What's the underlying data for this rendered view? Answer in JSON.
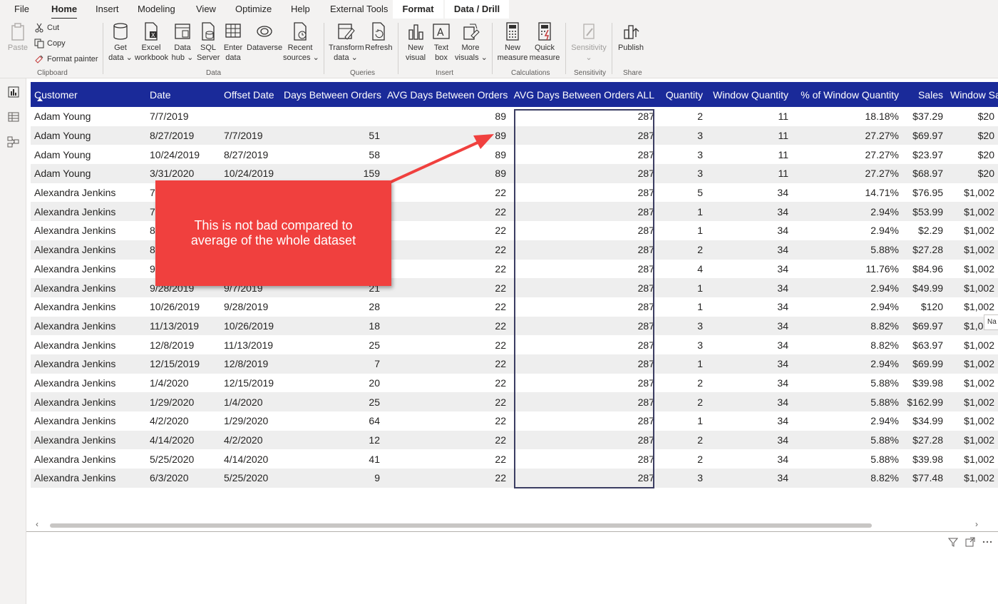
{
  "menu": {
    "file": "File",
    "home": "Home",
    "insert": "Insert",
    "modeling": "Modeling",
    "view": "View",
    "optimize": "Optimize",
    "help": "Help",
    "external_tools": "External Tools",
    "format": "Format",
    "data_drill": "Data / Drill"
  },
  "ribbon": {
    "clipboard": {
      "paste": "Paste",
      "cut": "Cut",
      "copy": "Copy",
      "format_painter": "Format painter",
      "label": "Clipboard"
    },
    "data": {
      "get_data": [
        "Get",
        "data ⌄"
      ],
      "excel": [
        "Excel",
        "workbook"
      ],
      "data_hub": [
        "Data",
        "hub ⌄"
      ],
      "sql": [
        "SQL",
        "Server"
      ],
      "enter": [
        "Enter",
        "data"
      ],
      "dataverse": [
        "Dataverse",
        ""
      ],
      "recent": [
        "Recent",
        "sources ⌄"
      ],
      "label": "Data"
    },
    "queries": {
      "transform": [
        "Transform",
        "data ⌄"
      ],
      "refresh": [
        "Refresh",
        ""
      ],
      "label": "Queries"
    },
    "insert": {
      "new_visual": [
        "New",
        "visual"
      ],
      "text_box": [
        "Text",
        "box"
      ],
      "more_visuals": [
        "More",
        "visuals ⌄"
      ],
      "label": "Insert"
    },
    "calculations": {
      "new_measure": [
        "New",
        "measure"
      ],
      "quick_measure": [
        "Quick",
        "measure"
      ],
      "label": "Calculations"
    },
    "sensitivity": {
      "sensitivity": [
        "Sensitivity",
        "⌄"
      ],
      "label": "Sensitivity"
    },
    "share": {
      "publish": [
        "Publish",
        ""
      ],
      "label": "Share"
    }
  },
  "table": {
    "columns": [
      "Customer",
      "Date",
      "Offset Date",
      "Days Between Orders",
      "AVG Days Between Orders",
      "AVG Days Between Orders ALL",
      "Quantity",
      "Window Quantity",
      "% of Window Quantity",
      "Sales",
      "Window Sa"
    ],
    "rows": [
      [
        "Adam Young",
        "7/7/2019",
        "",
        "",
        "89",
        "287",
        "2",
        "11",
        "18.18%",
        "$37.29",
        "$20"
      ],
      [
        "Adam Young",
        "8/27/2019",
        "7/7/2019",
        "51",
        "89",
        "287",
        "3",
        "11",
        "27.27%",
        "$69.97",
        "$20"
      ],
      [
        "Adam Young",
        "10/24/2019",
        "8/27/2019",
        "58",
        "89",
        "287",
        "3",
        "11",
        "27.27%",
        "$23.97",
        "$20"
      ],
      [
        "Adam Young",
        "3/31/2020",
        "10/24/2019",
        "159",
        "89",
        "287",
        "3",
        "11",
        "27.27%",
        "$68.97",
        "$20"
      ],
      [
        "Alexandra Jenkins",
        "7",
        "",
        "",
        "22",
        "287",
        "5",
        "34",
        "14.71%",
        "$76.95",
        "$1,002"
      ],
      [
        "Alexandra Jenkins",
        "7",
        "",
        "",
        "22",
        "287",
        "1",
        "34",
        "2.94%",
        "$53.99",
        "$1,002"
      ],
      [
        "Alexandra Jenkins",
        "8",
        "",
        "",
        "22",
        "287",
        "1",
        "34",
        "2.94%",
        "$2.29",
        "$1,002"
      ],
      [
        "Alexandra Jenkins",
        "8",
        "",
        "",
        "22",
        "287",
        "2",
        "34",
        "5.88%",
        "$27.28",
        "$1,002"
      ],
      [
        "Alexandra Jenkins",
        "9",
        "",
        "",
        "22",
        "287",
        "4",
        "34",
        "11.76%",
        "$84.96",
        "$1,002"
      ],
      [
        "Alexandra Jenkins",
        "9/28/2019",
        "9/7/2019",
        "21",
        "22",
        "287",
        "1",
        "34",
        "2.94%",
        "$49.99",
        "$1,002"
      ],
      [
        "Alexandra Jenkins",
        "10/26/2019",
        "9/28/2019",
        "28",
        "22",
        "287",
        "1",
        "34",
        "2.94%",
        "$120",
        "$1,002"
      ],
      [
        "Alexandra Jenkins",
        "11/13/2019",
        "10/26/2019",
        "18",
        "22",
        "287",
        "3",
        "34",
        "8.82%",
        "$69.97",
        "$1,002"
      ],
      [
        "Alexandra Jenkins",
        "12/8/2019",
        "11/13/2019",
        "25",
        "22",
        "287",
        "3",
        "34",
        "8.82%",
        "$63.97",
        "$1,002"
      ],
      [
        "Alexandra Jenkins",
        "12/15/2019",
        "12/8/2019",
        "7",
        "22",
        "287",
        "1",
        "34",
        "2.94%",
        "$69.99",
        "$1,002"
      ],
      [
        "Alexandra Jenkins",
        "1/4/2020",
        "12/15/2019",
        "20",
        "22",
        "287",
        "2",
        "34",
        "5.88%",
        "$39.98",
        "$1,002"
      ],
      [
        "Alexandra Jenkins",
        "1/29/2020",
        "1/4/2020",
        "25",
        "22",
        "287",
        "2",
        "34",
        "5.88%",
        "$162.99",
        "$1,002"
      ],
      [
        "Alexandra Jenkins",
        "4/2/2020",
        "1/29/2020",
        "64",
        "22",
        "287",
        "1",
        "34",
        "2.94%",
        "$34.99",
        "$1,002"
      ],
      [
        "Alexandra Jenkins",
        "4/14/2020",
        "4/2/2020",
        "12",
        "22",
        "287",
        "2",
        "34",
        "5.88%",
        "$27.28",
        "$1,002"
      ],
      [
        "Alexandra Jenkins",
        "5/25/2020",
        "4/14/2020",
        "41",
        "22",
        "287",
        "2",
        "34",
        "5.88%",
        "$39.98",
        "$1,002"
      ],
      [
        "Alexandra Jenkins",
        "6/3/2020",
        "5/25/2020",
        "9",
        "22",
        "287",
        "3",
        "34",
        "8.82%",
        "$77.48",
        "$1,002"
      ]
    ]
  },
  "callout": {
    "line1": "This is not bad compared to",
    "line2": "average of the whole dataset"
  },
  "tooltip_stub": "Na",
  "colors": {
    "header_bg": "#1a2a99",
    "callout": "#f0403e",
    "highlight_border": "#3b3d62"
  },
  "icons": [
    "filter-icon",
    "focus-mode-icon",
    "more-options-icon",
    "report-view-icon",
    "table-view-icon",
    "model-view-icon"
  ]
}
